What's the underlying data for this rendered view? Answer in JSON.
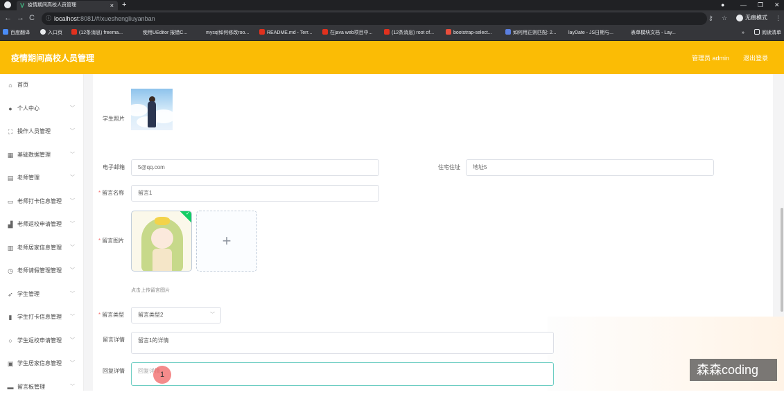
{
  "browser": {
    "tab_title": "疫情期间高校人员管理",
    "url_host": "localhost",
    "url_path": ":8081/#/xueshengliuyanban",
    "profile_label": "无痕模式",
    "bookmarks": [
      "百度翻译",
      "入口页",
      "(12条消息) freema...",
      "使用UEditor 报错C...",
      "mysql如何修改roo...",
      "README.md - Terr...",
      "在java web项目中...",
      "(12条消息) root of...",
      "bootstrap-select...",
      "如何用正则匹配: 2...",
      "layDate - JS日期与...",
      "表单模块文档 - Lay..."
    ],
    "reading_list": "阅读清单"
  },
  "app": {
    "title": "疫情期间高校人员管理",
    "user": "管理员 admin",
    "logout": "退出登录"
  },
  "sidebar": {
    "items": [
      {
        "label": "首页",
        "icon": "home-icon",
        "glyph": "⌂",
        "expandable": false
      },
      {
        "label": "个人中心",
        "icon": "user-icon",
        "glyph": "●",
        "expandable": true
      },
      {
        "label": "操作人员管理",
        "icon": "frame-icon",
        "glyph": "⛶",
        "expandable": true
      },
      {
        "label": "基础数据管理",
        "icon": "grid-icon",
        "glyph": "▦",
        "expandable": true
      },
      {
        "label": "老师管理",
        "icon": "table-icon",
        "glyph": "▤",
        "expandable": true
      },
      {
        "label": "老师打卡信息管理",
        "icon": "message-icon",
        "glyph": "▭",
        "expandable": true
      },
      {
        "label": "老师返校申请管理",
        "icon": "chart-icon",
        "glyph": "▟",
        "expandable": true
      },
      {
        "label": "老师居家信息管理",
        "icon": "building-icon",
        "glyph": "▥",
        "expandable": true
      },
      {
        "label": "老师请假管理管理",
        "icon": "clock-icon",
        "glyph": "◷",
        "expandable": true
      },
      {
        "label": "学生管理",
        "icon": "send-icon",
        "glyph": "➶",
        "expandable": true
      },
      {
        "label": "学生打卡信息管理",
        "icon": "bar-chart-icon",
        "glyph": "▮",
        "expandable": true
      },
      {
        "label": "学生返校申请管理",
        "icon": "circle-icon",
        "glyph": "○",
        "expandable": true
      },
      {
        "label": "学生居家信息管理",
        "icon": "document-icon",
        "glyph": "▣",
        "expandable": true
      },
      {
        "label": "留言板管理",
        "icon": "board-icon",
        "glyph": "▬",
        "expandable": true
      }
    ]
  },
  "form": {
    "student_photo_label": "学生照片",
    "email_label": "电子邮箱",
    "email_value": "5@qq.com",
    "address_label": "住宅住址",
    "address_value": "地址5",
    "message_name_label": "留言名称",
    "message_name_value": "留言1",
    "message_image_label": "留言图片",
    "upload_tip": "点击上传留言图片",
    "message_type_label": "留言类型",
    "message_type_value": "留言类型2",
    "message_detail_label": "留言详情",
    "message_detail_value": "留言1的详情",
    "reply_label": "回复详情",
    "reply_placeholder": "回复详情",
    "required_mark": "*"
  },
  "overlay": {
    "cursor_label": "1",
    "watermark": "森森coding"
  }
}
